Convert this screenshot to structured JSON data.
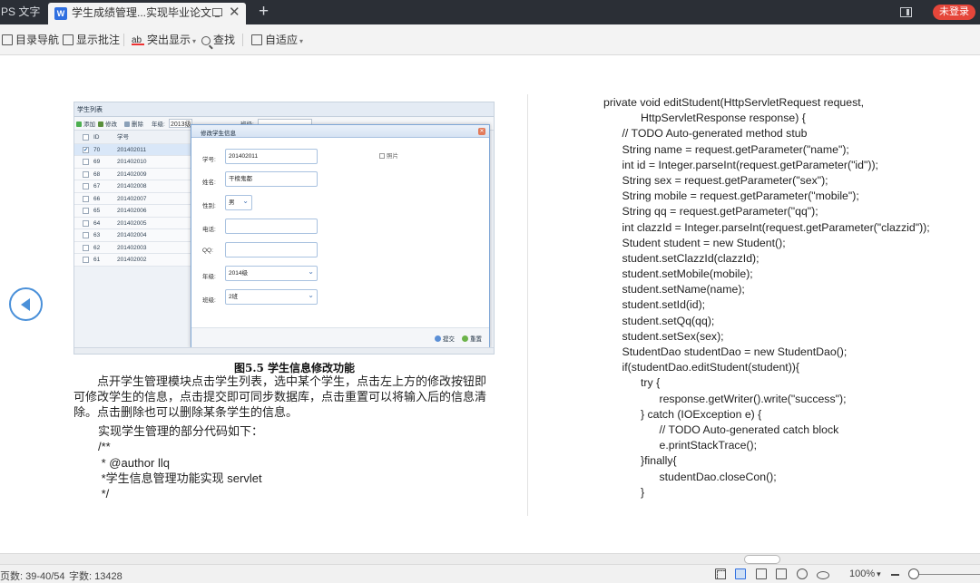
{
  "tabs": {
    "app_tab": "PS 文字",
    "doc_tab": "学生成绩管理...实现毕业论文",
    "new_tab": "+",
    "close": "✕",
    "login": "未登录"
  },
  "toolbar": {
    "nav": "目录导航",
    "annot": "显示批注",
    "highlight": "突出显示",
    "find": "查找",
    "fit": "自适应"
  },
  "figure": {
    "panel_title": "学生列表",
    "tools": [
      "添加",
      "修改",
      "删除"
    ],
    "grade_label": "年级:",
    "grade_value": "2013级",
    "class_label": "班级:",
    "grid_header": {
      "id": "ID",
      "sn": "学号"
    },
    "rows": [
      {
        "id": "70",
        "sn": "201402011",
        "checked": "✔"
      },
      {
        "id": "69",
        "sn": "201402010"
      },
      {
        "id": "68",
        "sn": "201402009"
      },
      {
        "id": "67",
        "sn": "201402008"
      },
      {
        "id": "66",
        "sn": "201402007"
      },
      {
        "id": "65",
        "sn": "201402006"
      },
      {
        "id": "64",
        "sn": "201402005"
      },
      {
        "id": "63",
        "sn": "201402004"
      },
      {
        "id": "62",
        "sn": "201402003"
      },
      {
        "id": "61",
        "sn": "201402002"
      }
    ],
    "dialog": {
      "title": "修改学生信息",
      "close": "✕",
      "photo": "照片",
      "fields": {
        "sn_label": "学号:",
        "sn_value": "201402011",
        "name_label": "姓名:",
        "name_value": "干榜鬼都",
        "sex_label": "性别:",
        "sex_value": "男",
        "phone_label": "电话:",
        "qq_label": "QQ:",
        "grade_label": "年级:",
        "grade_value": "2014级",
        "class_label": "班级:",
        "class_value": "2班"
      },
      "submit": "提交",
      "reset": "重置"
    }
  },
  "doc": {
    "caption": "图5.5 学生信息修改功能",
    "paragraph": "　　点开学生管理模块点击学生列表，选中某个学生，点击左上方的修改按钮即可修改学生的信息，点击提交即可同步数据库，点击重置可以将输入后的信息清除。点击删除也可以删除某条学生的信息。",
    "intro": "实现学生管理的部分代码如下：",
    "comment_lines": [
      "/**",
      " * @author llq",
      " *学生信息管理功能实现 servlet",
      " */"
    ]
  },
  "code_lines": [
    "private void editStudent(HttpServletRequest request,",
    "            HttpServletResponse response) {",
    "      // TODO Auto-generated method stub",
    "      String name = request.getParameter(\"name\");",
    "      int id = Integer.parseInt(request.getParameter(\"id\"));",
    "      String sex = request.getParameter(\"sex\");",
    "      String mobile = request.getParameter(\"mobile\");",
    "      String qq = request.getParameter(\"qq\");",
    "      int clazzId = Integer.parseInt(request.getParameter(\"clazzid\"));",
    "      Student student = new Student();",
    "      student.setClazzId(clazzId);",
    "      student.setMobile(mobile);",
    "      student.setName(name);",
    "      student.setId(id);",
    "      student.setQq(qq);",
    "      student.setSex(sex);",
    "      StudentDao studentDao = new StudentDao();",
    "      if(studentDao.editStudent(student)){",
    "            try {",
    "                  response.getWriter().write(\"success\");",
    "            } catch (IOException e) {",
    "                  // TODO Auto-generated catch block",
    "                  e.printStackTrace();",
    "            }finally{",
    "                  studentDao.closeCon();",
    "            }"
  ],
  "status": {
    "pages": "页数: 39-40/54",
    "words": "字数: 13428",
    "zoom": "100%",
    "zoom_caret": "▾"
  },
  "colors": {
    "accent": "#4a90d9",
    "login_badge": "#e5463a",
    "tabbar": "#2b2f36"
  }
}
